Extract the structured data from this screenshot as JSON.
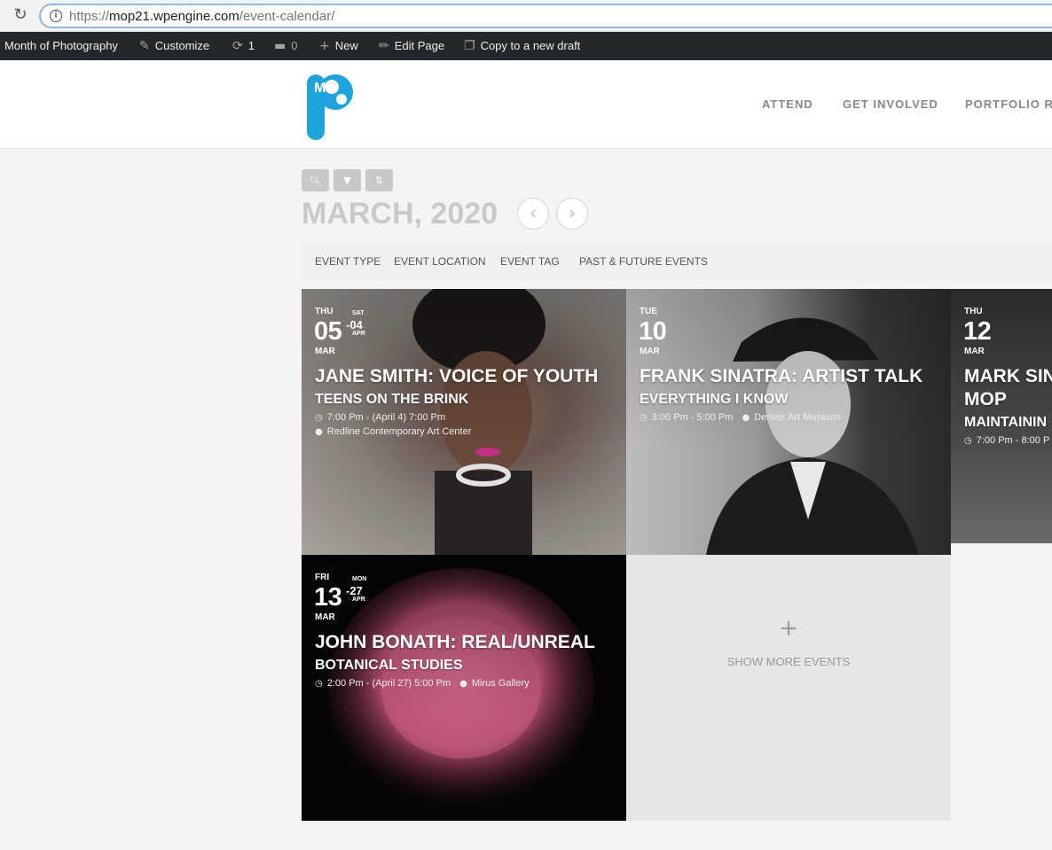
{
  "browser": {
    "url_prefix": "https://",
    "url_host": "mop21.wpengine.com",
    "url_path": "/event-calendar/"
  },
  "admin_bar": {
    "site_name": "Month of Photography",
    "customize": "Customize",
    "updates_count": "1",
    "comments_count": "0",
    "new": "New",
    "edit_page": "Edit Page",
    "copy_draft": "Copy to a new draft"
  },
  "nav": {
    "items": [
      "ATTEND",
      "GET INVOLVED",
      "PORTFOLIO RE"
    ]
  },
  "calendar": {
    "month_title": "MARCH, 2020",
    "filters": [
      "EVENT TYPE",
      "EVENT LOCATION",
      "EVENT TAG",
      "PAST & FUTURE EVENTS"
    ]
  },
  "events": [
    {
      "start_dow": "THU",
      "start_day": "05",
      "start_month": "MAR",
      "end_dow": "SAT",
      "end_day": "-04",
      "end_month": "APR",
      "title": "JANE SMITH: VOICE OF YOUTH",
      "subtitle": "TEENS ON THE BRINK",
      "time": "7:00 Pm - (April 4) 7:00 Pm",
      "location": "Redline Contemporary Art Center"
    },
    {
      "start_dow": "TUE",
      "start_day": "10",
      "start_month": "MAR",
      "title": "FRANK SINATRA: ARTIST TALK",
      "subtitle": "EVERYTHING I KNOW",
      "time": "3:00 Pm - 5:00 Pm",
      "location": "Denver Art Museum"
    },
    {
      "start_dow": "THU",
      "start_day": "12",
      "start_month": "MAR",
      "title": "MARK SIN",
      "title2": "MOP",
      "subtitle": "MAINTAININ",
      "time": "7:00 Pm - 8:00 P"
    },
    {
      "start_dow": "FRI",
      "start_day": "13",
      "start_month": "MAR",
      "end_dow": "MON",
      "end_day": "-27",
      "end_month": "APR",
      "title": "JOHN BONATH: REAL/UNREAL",
      "subtitle": "BOTANICAL STUDIES",
      "time": "2:00 Pm - (April 27) 5:00 Pm",
      "location": "Mirus Gallery"
    }
  ],
  "show_more": {
    "plus": "+",
    "label": "SHOW MORE EVENTS"
  }
}
